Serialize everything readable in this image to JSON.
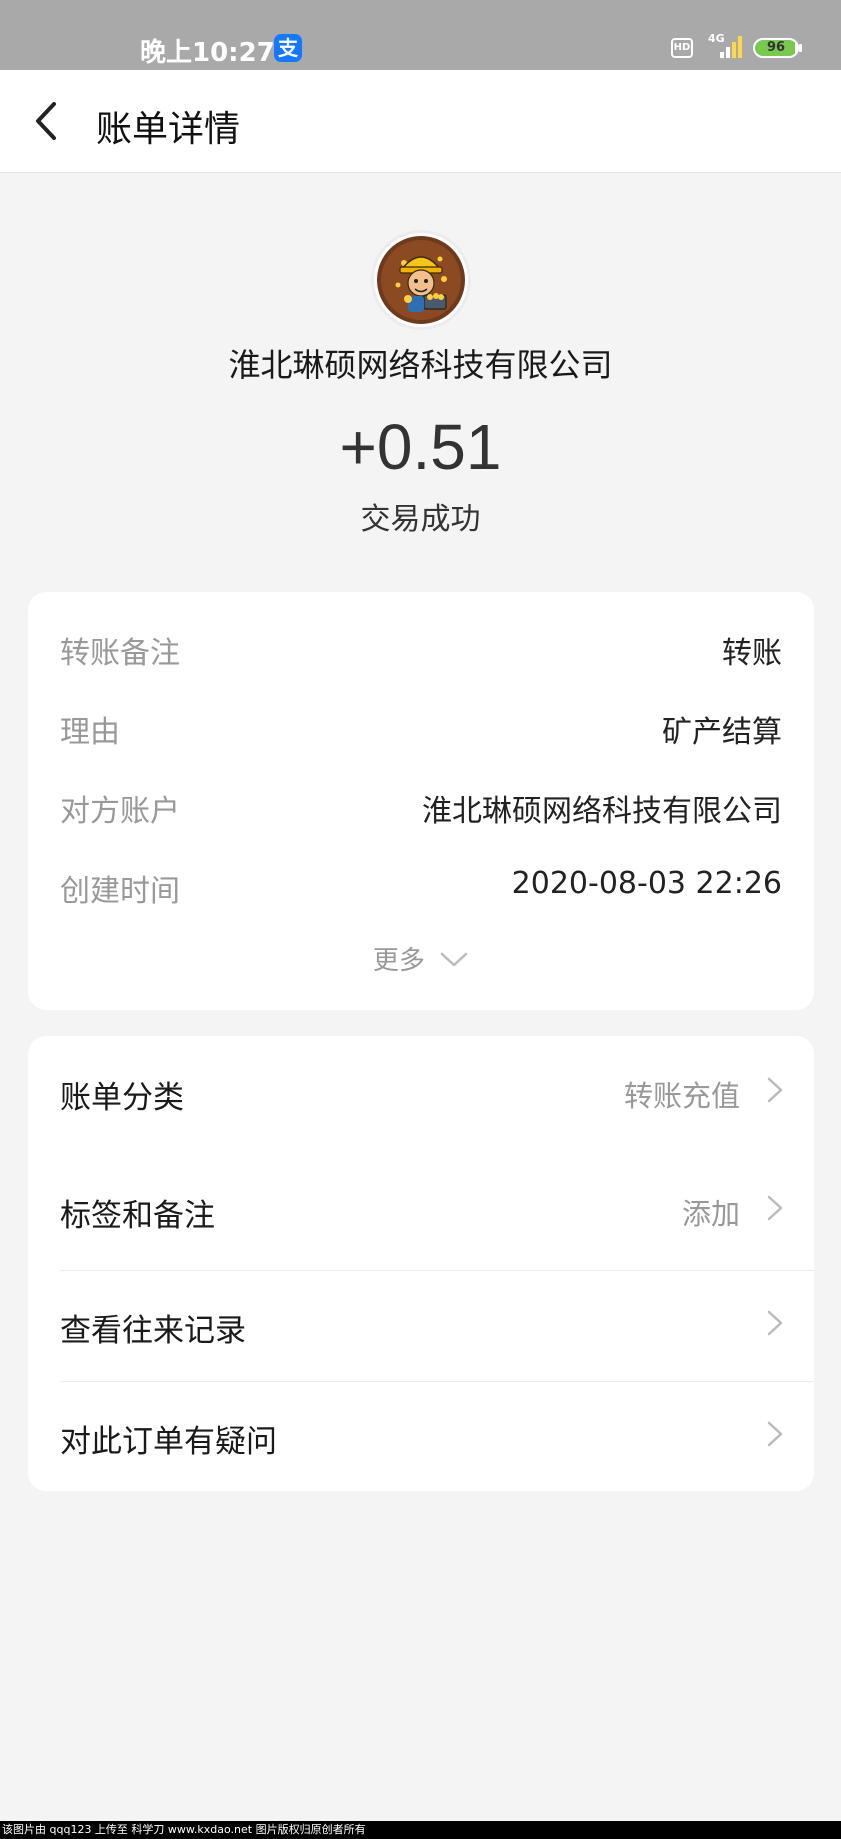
{
  "status_bar": {
    "time": "晚上10:27",
    "app_badge": "支",
    "hd": "HD",
    "network": "4G",
    "battery": "96",
    "battery_fraction": 0.96
  },
  "nav": {
    "back_icon": "chevron-left-icon",
    "title": "账单详情"
  },
  "header": {
    "avatar_icon": "miner-avatar",
    "company": "淮北琳硕网络科技有限公司",
    "amount": "+0.51",
    "status": "交易成功"
  },
  "details": [
    {
      "label": "转账备注",
      "value": "转账"
    },
    {
      "label": "理由",
      "value": "矿产结算"
    },
    {
      "label": "对方账户",
      "value": "淮北琳硕网络科技有限公司"
    },
    {
      "label": "创建时间",
      "value": "2020-08-03 22:26"
    }
  ],
  "more_label": "更多",
  "menu": [
    {
      "label": "账单分类",
      "value": "转账充值"
    },
    {
      "label": "标签和备注",
      "value": "添加"
    },
    {
      "label": "查看往来记录",
      "value": ""
    },
    {
      "label": "对此订单有疑问",
      "value": ""
    }
  ],
  "footer_note": "该图片由 qqq123 上传至 科学刀 www.kxdao.net 图片版权归原创者所有",
  "colors": {
    "status_bar_bg": "#a9a9aa",
    "page_bg": "#f4f4f5",
    "alipay_blue": "#1677ff",
    "battery_green": "#79c850"
  }
}
